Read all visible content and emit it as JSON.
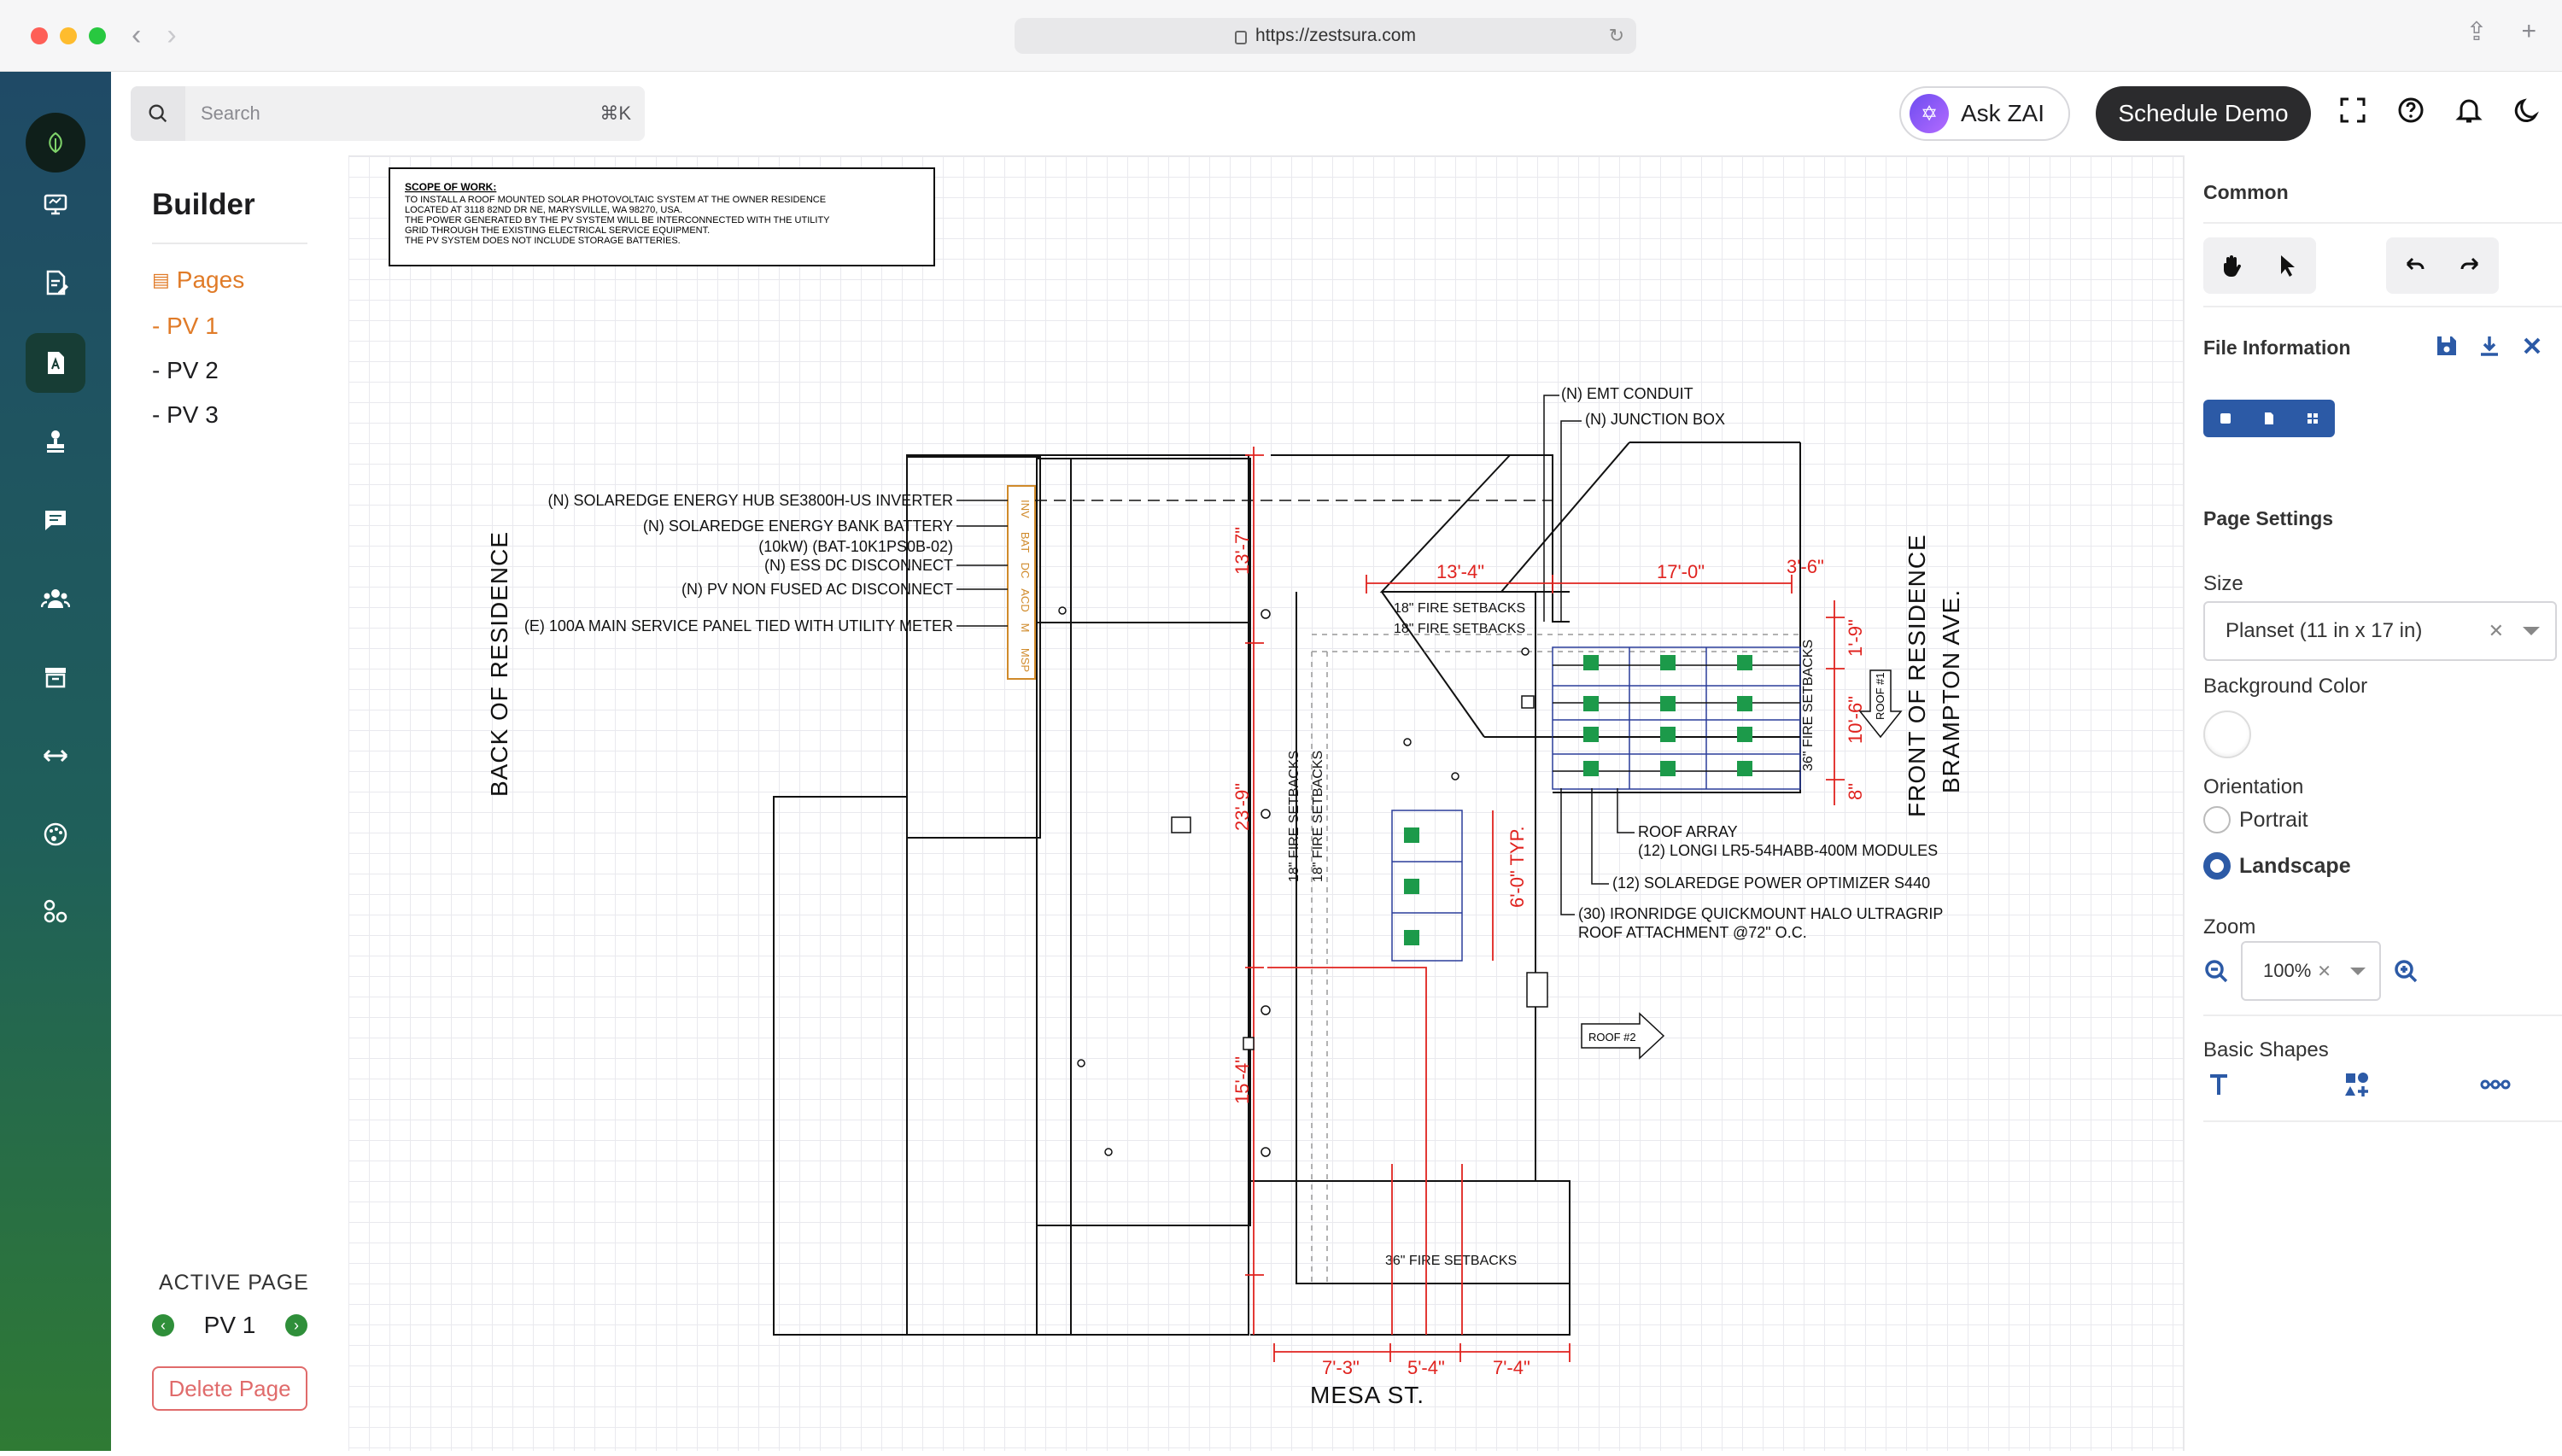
{
  "browser": {
    "url": "https://zestsura.com",
    "traffic_lights": [
      "#fe5f57",
      "#febc2e",
      "#28c840"
    ]
  },
  "sidebar_rail": {
    "items": [
      {
        "icon": "desktop-icon"
      },
      {
        "icon": "document-edit-icon"
      },
      {
        "icon": "builder-icon",
        "active": true
      },
      {
        "icon": "stamp-icon"
      },
      {
        "icon": "chat-icon"
      },
      {
        "icon": "team-icon"
      },
      {
        "icon": "archive-icon"
      },
      {
        "icon": "swap-arrows-icon"
      },
      {
        "icon": "palette-icon"
      },
      {
        "icon": "integrations-icon"
      }
    ]
  },
  "builder": {
    "title": "Builder",
    "pages_label": "Pages",
    "pages": [
      "- PV 1",
      "- PV 2",
      "- PV 3"
    ],
    "active_page_heading": "ACTIVE PAGE",
    "active_page": "PV 1",
    "delete_label": "Delete Page"
  },
  "search": {
    "placeholder": "Search",
    "shortcut": "⌘K"
  },
  "header": {
    "ask_zai": "Ask ZAI",
    "schedule_demo": "Schedule Demo"
  },
  "drawing": {
    "scope_title": "SCOPE OF WORK:",
    "scope_lines": [
      "TO INSTALL A ROOF MOUNTED SOLAR PHOTOVOLTAIC SYSTEM AT THE OWNER RESIDENCE",
      "LOCATED AT 3118 82ND DR NE, MARYSVILLE, WA 98270, USA.",
      "THE POWER GENERATED BY THE PV SYSTEM WILL BE INTERCONNECTED WITH THE UTILITY",
      "GRID THROUGH THE EXISTING ELECTRICAL SERVICE EQUIPMENT.",
      "THE PV SYSTEM DOES NOT INCLUDE STORAGE BATTERIES."
    ],
    "equipment_labels": [
      "(N) SOLAREDGE ENERGY HUB SE3800H-US INVERTER",
      "(N) SOLAREDGE ENERGY BANK BATTERY",
      "(10kW) (BAT-10K1PS0B-02)",
      "(N) ESS DC DISCONNECT",
      "(N) PV NON FUSED AC DISCONNECT",
      "(E) 100A MAIN SERVICE PANEL TIED WITH UTILITY METER"
    ],
    "equipment_tags": [
      "INV",
      "BAT",
      "DC",
      "ACD",
      "M",
      "MSP"
    ],
    "conduit_labels": [
      "(N) EMT CONDUIT",
      "(N) JUNCTION BOX"
    ],
    "array_labels": [
      "ROOF ARRAY",
      "(12) LONGI LR5-54HABB-400M MODULES",
      "(12) SOLAREDGE POWER OPTIMIZER S440",
      "(30) IRONRIDGE QUICKMOUNT HALO ULTRAGRIP",
      "ROOF ATTACHMENT @72\" O.C."
    ],
    "setbacks": [
      "18\" FIRE SETBACKS",
      "18\" FIRE SETBACKS",
      "18\" FIRE SETBACKS",
      "18\" FIRE SETBACKS",
      "36\" FIRE SETBACKS",
      "36\" FIRE SETBACKS"
    ],
    "dims_top": [
      "13'-4\"",
      "17'-0\"",
      "3'-6\""
    ],
    "dims_left": [
      "13'-7\"",
      "23'-9\"",
      "15'-4\""
    ],
    "dims_right": [
      "1'-9\"",
      "10'-6\"",
      "8\""
    ],
    "dims_bottom": [
      "7'-3\"",
      "5'-4\"",
      "7'-4\""
    ],
    "dim_typ": "6'-0\" TYP.",
    "roof_tags": [
      "ROOF #1",
      "ROOF #2"
    ],
    "streets": [
      "BACK OF RESIDENCE",
      "FRONT OF RESIDENCE",
      "BRAMPTON AVE.",
      "MESA ST."
    ],
    "colors": {
      "dimension": "#e0231f",
      "module": "#1c9a4a",
      "array": "#2a3d9a",
      "equipment": "#d08a2a"
    }
  },
  "panel": {
    "common": "Common",
    "file_info": "File Information",
    "page_settings": "Page Settings",
    "size_label": "Size",
    "size_value": "Planset (11 in x 17 in)",
    "background_label": "Background Color",
    "orientation_label": "Orientation",
    "portrait": "Portrait",
    "landscape": "Landscape",
    "zoom_label": "Zoom",
    "zoom_value": "100%",
    "shapes_label": "Basic Shapes",
    "accent": "#2c5aa6"
  }
}
